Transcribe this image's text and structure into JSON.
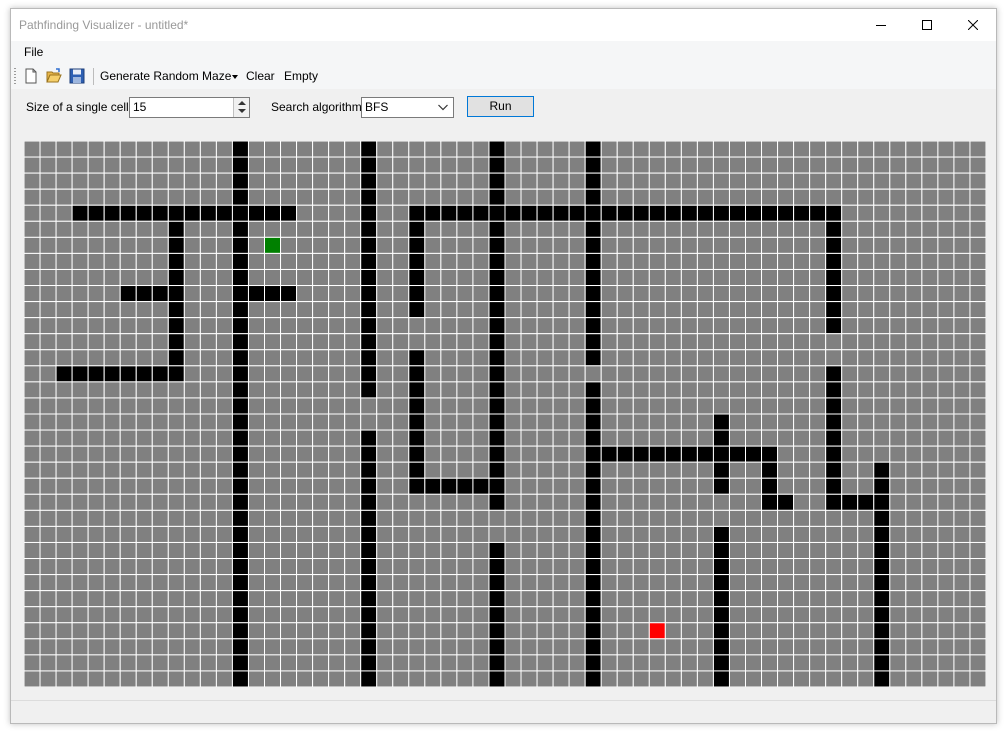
{
  "window": {
    "title": "Pathfinding Visualizer - untitled*"
  },
  "menu": {
    "items": [
      "File"
    ]
  },
  "toolbar": {
    "icons": [
      "new-file-icon",
      "open-folder-icon",
      "save-disk-icon"
    ],
    "generate_label": "Generate Random Maze",
    "clear_label": "Clear",
    "empty_label": "Empty"
  },
  "controls": {
    "cell_size_label": "Size of a single cell:",
    "cell_size_value": "15",
    "algorithm_label": "Search algorithm:",
    "algorithm_value": "BFS",
    "run_label": "Run"
  },
  "grid": {
    "cols": 60,
    "rows": 34,
    "colors": {
      "empty": "#808080",
      "wall": "#000000",
      "start": "#008000",
      "end": "#ff0000",
      "lines": "#ffffff"
    },
    "start": [
      15,
      6
    ],
    "end": [
      39,
      30
    ],
    "walls": [
      [
        13,
        0,
        13,
        33
      ],
      [
        21,
        0,
        21,
        15
      ],
      [
        21,
        18,
        21,
        33
      ],
      [
        29,
        0,
        29,
        22
      ],
      [
        29,
        25,
        29,
        33
      ],
      [
        35,
        0,
        35,
        13
      ],
      [
        35,
        15,
        35,
        33
      ],
      [
        3,
        4,
        16,
        4
      ],
      [
        24,
        4,
        50,
        4
      ],
      [
        9,
        5,
        9,
        14
      ],
      [
        6,
        9,
        9,
        9
      ],
      [
        14,
        9,
        16,
        9
      ],
      [
        2,
        14,
        9,
        14
      ],
      [
        24,
        5,
        24,
        10
      ],
      [
        24,
        13,
        24,
        21
      ],
      [
        24,
        21,
        28,
        21
      ],
      [
        50,
        5,
        50,
        11
      ],
      [
        50,
        14,
        50,
        22
      ],
      [
        51,
        22,
        52,
        22
      ],
      [
        53,
        20,
        53,
        33
      ],
      [
        36,
        19,
        46,
        19
      ],
      [
        43,
        17,
        43,
        21
      ],
      [
        43,
        24,
        43,
        33
      ],
      [
        46,
        20,
        46,
        22
      ],
      [
        47,
        22,
        47,
        22
      ]
    ]
  }
}
